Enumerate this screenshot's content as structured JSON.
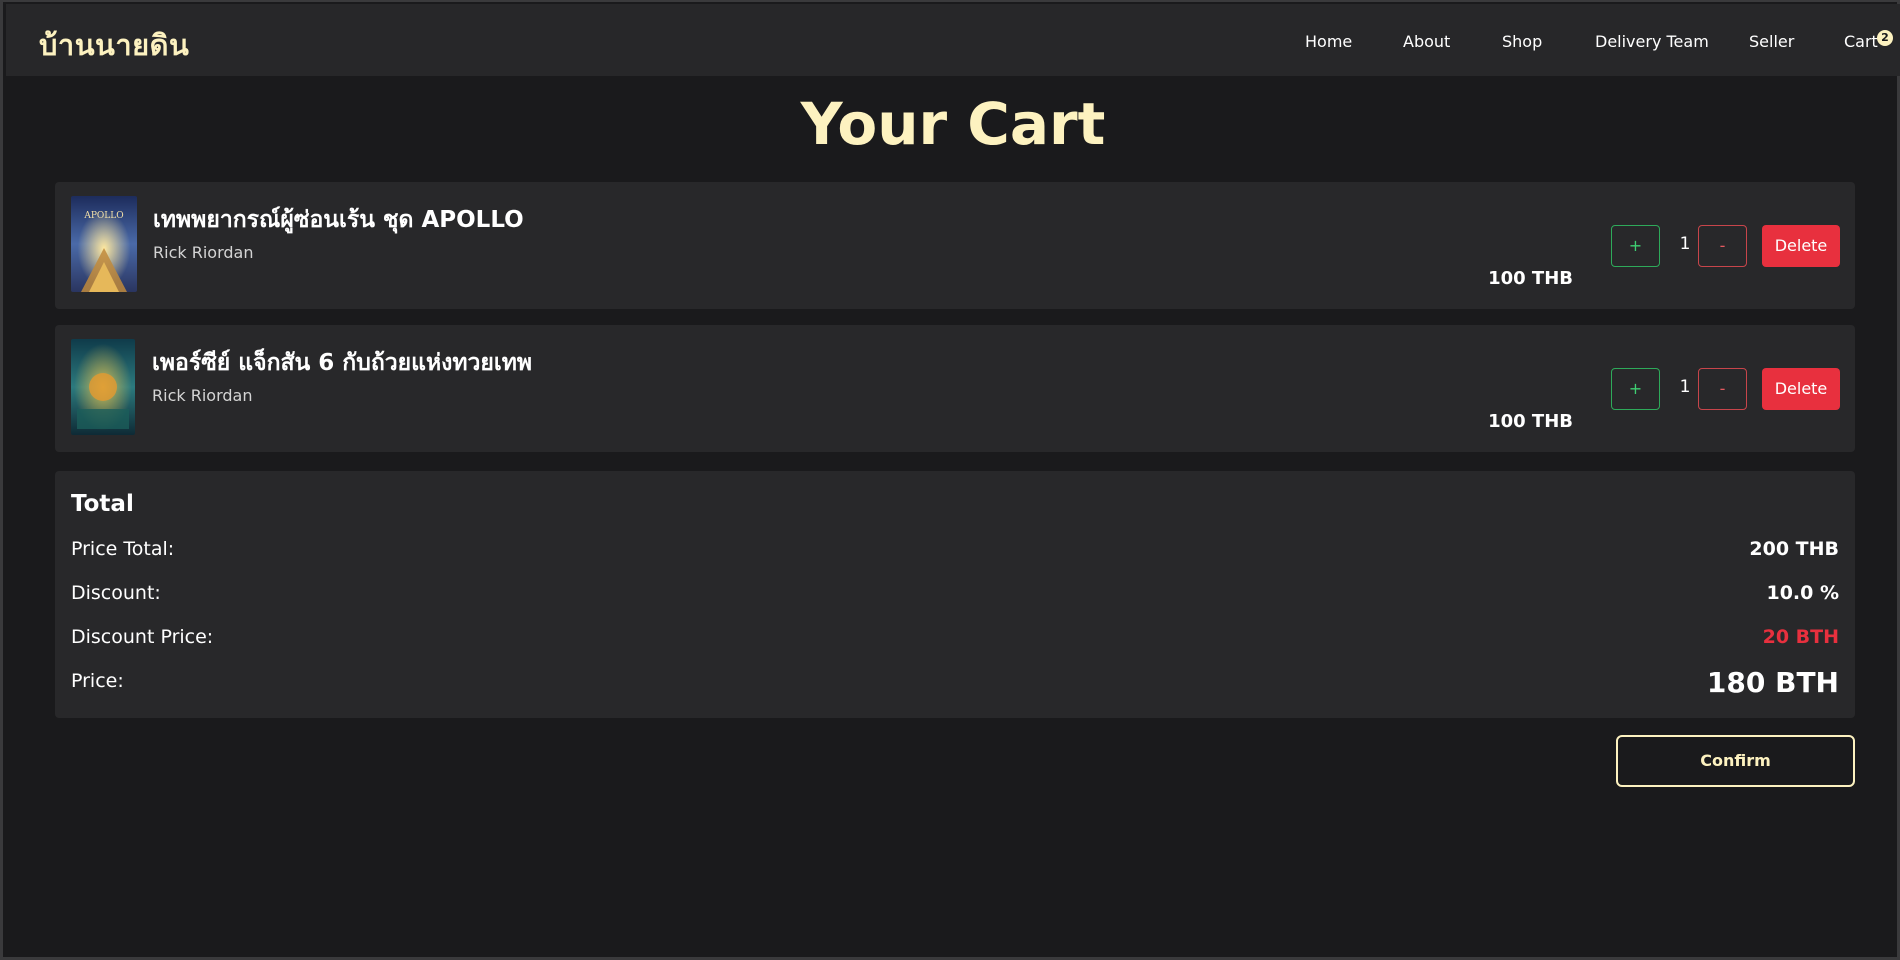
{
  "brand": "บ้านนายดิน",
  "nav": {
    "home": "Home",
    "about": "About",
    "shop": "Shop",
    "delivery_team": "Delivery Team",
    "seller": "Seller",
    "cart": "Cart",
    "cart_count": "2"
  },
  "page_title": "Your Cart",
  "items": [
    {
      "title": "เทพพยากรณ์ผู้ซ่อนเร้น ชุด APOLLO",
      "author": "Rick Riordan",
      "price": "100 THB",
      "quantity": "1",
      "plus_label": "+",
      "minus_label": "-",
      "delete_label": "Delete",
      "cover_text": "APOLLO"
    },
    {
      "title": "เพอร์ซีย์ แจ็กสัน 6 กับถ้วยแห่งทวยเทพ",
      "author": "Rick Riordan",
      "price": "100 THB",
      "quantity": "1",
      "plus_label": "+",
      "minus_label": "-",
      "delete_label": "Delete"
    }
  ],
  "total": {
    "heading": "Total",
    "price_total_label": "Price Total:",
    "price_total_value": "200 THB",
    "discount_label": "Discount:",
    "discount_value": "10.0 %",
    "discount_price_label": "Discount Price:",
    "discount_price_value": "20 BTH",
    "price_label": "Price:",
    "price_value": "180 BTH"
  },
  "confirm_label": "Confirm",
  "colors": {
    "accent": "#fdf2c0",
    "danger": "#e8303e",
    "success": "#3fcf72",
    "background": "#1a1a1c",
    "panel": "#28282a"
  }
}
